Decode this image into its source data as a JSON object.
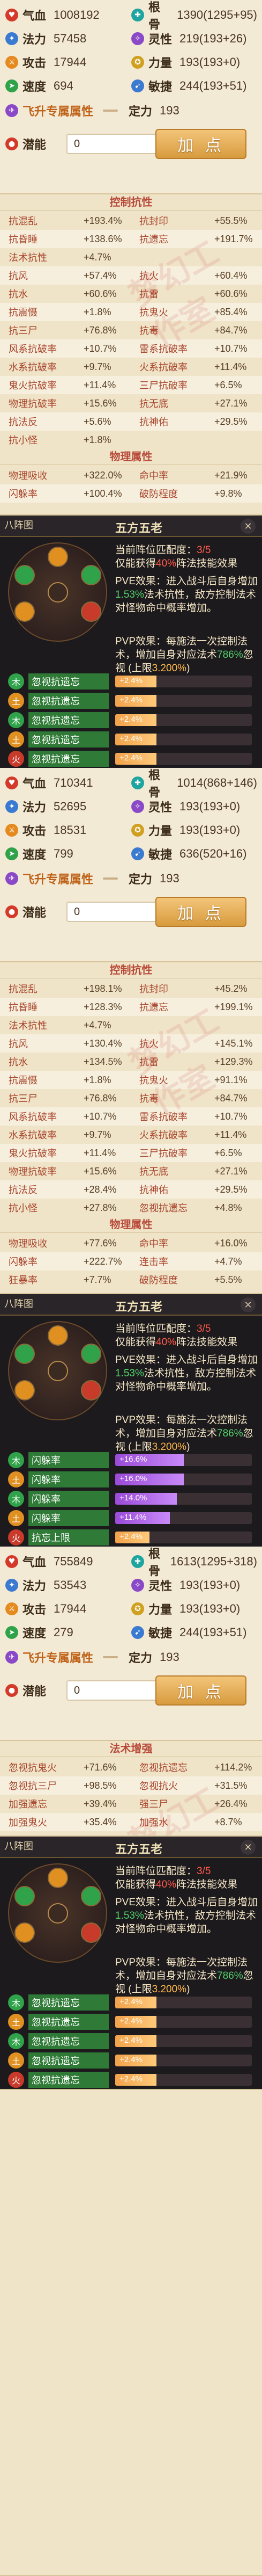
{
  "section1": {
    "stats": [
      {
        "icon": "heart-icon",
        "label": "气血",
        "value": "1008192",
        "label2": "根骨",
        "value2": "1390(1295+95)"
      },
      {
        "icon": "magic-icon",
        "label": "法力",
        "value": "57458",
        "label2": "灵性",
        "value2": "219(193+26)"
      },
      {
        "icon": "sword-icon",
        "label": "攻击",
        "value": "17944",
        "label2": "力量",
        "value2": "193(193+0)"
      },
      {
        "icon": "boot-icon",
        "label": "速度",
        "value": "694",
        "label2": "敏捷",
        "value2": "244(193+51)"
      }
    ],
    "special_label": "飞升专属属性",
    "special_label2": "定力",
    "special_value2": "193",
    "potential_label": "潜能",
    "potential_value": "0",
    "add_button": "加 点"
  },
  "attrs1": {
    "title": "控制抗性",
    "rows": [
      [
        "抗混乱",
        "+193.4%",
        "抗封印",
        "+55.5%"
      ],
      [
        "抗昏睡",
        "+138.6%",
        "抗遗忘",
        "+191.7%"
      ],
      [
        "法术抗性",
        "+4.7%",
        "",
        ""
      ],
      [
        "抗风",
        "+57.4%",
        "抗火",
        "+60.4%"
      ],
      [
        "抗水",
        "+60.6%",
        "抗雷",
        "+60.6%"
      ],
      [
        "抗震慑",
        "+1.8%",
        "抗鬼火",
        "+85.4%"
      ],
      [
        "抗三尸",
        "+76.8%",
        "抗毒",
        "+84.7%"
      ],
      [
        "风系抗破率",
        "+10.7%",
        "雷系抗破率",
        "+10.7%"
      ],
      [
        "水系抗破率",
        "+9.7%",
        "火系抗破率",
        "+11.4%"
      ],
      [
        "鬼火抗破率",
        "+11.4%",
        "三尸抗破率",
        "+6.5%"
      ],
      [
        "物理抗破率",
        "+15.6%",
        "抗无底",
        "+27.1%"
      ],
      [
        "抗法反",
        "+5.6%",
        "抗神佑",
        "+29.5%"
      ],
      [
        "抗小怪",
        "+1.8%",
        "",
        ""
      ]
    ],
    "title2": "物理属性",
    "rows2": [
      [
        "物理吸收",
        "+322.0%",
        "命中率",
        "+21.9%"
      ],
      [
        "闪躲率",
        "+100.4%",
        "破防程度",
        "+9.8%"
      ]
    ]
  },
  "zhen1": {
    "tab": "八阵图",
    "name": "五方五老",
    "lines": [
      "当前阵位匹配度：",
      "3/5",
      "仅能获得",
      "40%",
      "阵法技能效果",
      "PVE效果：进入战斗后自身增加",
      "1.53%",
      "法术抗性，敌方控制法术对怪物命中概率增加。",
      "PVP效果：每施法一次控制法术，增加自身对应法术",
      "786%",
      "忽视 (上限",
      "3.200%",
      ")"
    ],
    "slots": [
      {
        "tag": "忽视抗遗忘",
        "bar": "+2.4%",
        "fill": 0.3
      },
      {
        "tag": "忽视抗遗忘",
        "bar": "+2.4%",
        "fill": 0.3
      },
      {
        "tag": "忽视抗遗忘",
        "bar": "+2.4%",
        "fill": 0.3
      },
      {
        "tag": "忽视抗遗忘",
        "bar": "+2.4%",
        "fill": 0.3
      },
      {
        "tag": "忽视抗遗忘",
        "bar": "+2.4%",
        "fill": 0.3
      }
    ]
  },
  "section2": {
    "stats": [
      {
        "icon": "heart-icon",
        "label": "气血",
        "value": "710341",
        "label2": "根骨",
        "value2": "1014(868+146)"
      },
      {
        "icon": "magic-icon",
        "label": "法力",
        "value": "52695",
        "label2": "灵性",
        "value2": "193(193+0)"
      },
      {
        "icon": "sword-icon",
        "label": "攻击",
        "value": "18531",
        "label2": "力量",
        "value2": "193(193+0)"
      },
      {
        "icon": "boot-icon",
        "label": "速度",
        "value": "799",
        "label2": "敏捷",
        "value2": "636(520+16)"
      }
    ],
    "special_label": "飞升专属属性",
    "special_label2": "定力",
    "special_value2": "193",
    "potential_label": "潜能",
    "potential_value": "0",
    "add_button": "加 点"
  },
  "attrs2": {
    "title": "控制抗性",
    "rows": [
      [
        "抗混乱",
        "+198.1%",
        "抗封印",
        "+45.2%"
      ],
      [
        "抗昏睡",
        "+128.3%",
        "抗遗忘",
        "+199.1%"
      ],
      [
        "法术抗性",
        "+4.7%",
        "",
        ""
      ],
      [
        "抗风",
        "+130.4%",
        "抗火",
        "+145.1%"
      ],
      [
        "抗水",
        "+134.5%",
        "抗雷",
        "+129.3%"
      ],
      [
        "抗震慑",
        "+1.8%",
        "抗鬼火",
        "+91.1%"
      ],
      [
        "抗三尸",
        "+76.8%",
        "抗毒",
        "+84.7%"
      ],
      [
        "风系抗破率",
        "+10.7%",
        "雷系抗破率",
        "+10.7%"
      ],
      [
        "水系抗破率",
        "+9.7%",
        "火系抗破率",
        "+11.4%"
      ],
      [
        "鬼火抗破率",
        "+11.4%",
        "三尸抗破率",
        "+6.5%"
      ],
      [
        "物理抗破率",
        "+15.6%",
        "抗无底",
        "+27.1%"
      ],
      [
        "抗法反",
        "+28.4%",
        "抗神佑",
        "+29.5%"
      ],
      [
        "抗小怪",
        "+27.8%",
        "忽视抗遗忘",
        "+4.8%"
      ]
    ],
    "title2": "物理属性",
    "rows2": [
      [
        "物理吸收",
        "+77.6%",
        "命中率",
        "+16.0%"
      ],
      [
        "闪躲率",
        "+222.7%",
        "连击率",
        "+4.7%"
      ],
      [
        "狂暴率",
        "+7.7%",
        "破防程度",
        "+5.5%"
      ]
    ]
  },
  "zhen2": {
    "tab": "八阵图",
    "name": "五方五老",
    "slots": [
      {
        "tag": "闪躲率",
        "bar": "+16.6%",
        "fill": 0.5
      },
      {
        "tag": "闪躲率",
        "bar": "+16.0%",
        "fill": 0.5
      },
      {
        "tag": "闪躲率",
        "bar": "+14.0%",
        "fill": 0.45
      },
      {
        "tag": "闪躲率",
        "bar": "+11.4%",
        "fill": 0.4
      },
      {
        "tag": "抗忘上限",
        "bar": "+2.4%",
        "fill": 0.25
      }
    ]
  },
  "section3": {
    "stats": [
      {
        "icon": "heart-icon",
        "label": "气血",
        "value": "755849",
        "label2": "根骨",
        "value2": "1613(1295+318)"
      },
      {
        "icon": "magic-icon",
        "label": "法力",
        "value": "53543",
        "label2": "灵性",
        "value2": "193(193+0)"
      },
      {
        "icon": "sword-icon",
        "label": "攻击",
        "value": "17944",
        "label2": "力量",
        "value2": "193(193+0)"
      },
      {
        "icon": "boot-icon",
        "label": "速度",
        "value": "279",
        "label2": "敏捷",
        "value2": "244(193+51)"
      }
    ],
    "special_label": "飞升专属属性",
    "special_label2": "定力",
    "special_value2": "193",
    "potential_label": "潜能",
    "potential_value": "0",
    "add_button": "加 点"
  },
  "attrs3": {
    "title": "法术增强",
    "rows": [
      [
        "忽视抗鬼火",
        "+71.6%",
        "忽视抗遗忘",
        "+114.2%"
      ],
      [
        "忽视抗三尸",
        "+98.5%",
        "忽视抗火",
        "+31.5%"
      ],
      [
        "加强遗忘",
        "+39.4%",
        "强三尸",
        "+26.4%"
      ],
      [
        "加强鬼火",
        "+35.4%",
        "加强水",
        "+8.7%"
      ]
    ]
  },
  "zhen3": {
    "tab": "八阵图",
    "name": "五方五老",
    "slots": [
      {
        "tag": "忽视抗遗忘",
        "bar": "+2.4%",
        "fill": 0.3
      },
      {
        "tag": "忽视抗遗忘",
        "bar": "+2.4%",
        "fill": 0.3
      },
      {
        "tag": "忽视抗遗忘",
        "bar": "+2.4%",
        "fill": 0.3
      },
      {
        "tag": "忽视抗遗忘",
        "bar": "+2.4%",
        "fill": 0.3
      },
      {
        "tag": "忽视抗遗忘",
        "bar": "+2.4%",
        "fill": 0.3
      }
    ]
  },
  "watermark": "梦幻工作室"
}
